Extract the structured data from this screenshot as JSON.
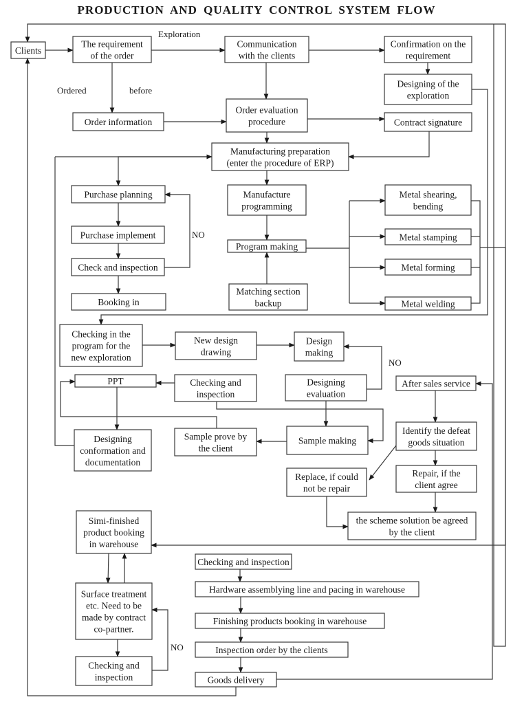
{
  "title": "PRODUCTION AND QUALITY CONTROL SYSTEM FLOW",
  "colors": {
    "line": "#3a3a3a",
    "text": "#1a1a1a",
    "background": "#ffffff"
  },
  "nodes": [
    {
      "id": "clients",
      "lines": [
        "Clients"
      ]
    },
    {
      "id": "requirement-of-order",
      "lines": [
        "The requirement",
        "of the order"
      ]
    },
    {
      "id": "communication-with-clients",
      "lines": [
        "Communication",
        "with the clients"
      ]
    },
    {
      "id": "confirmation-on-requirement",
      "lines": [
        "Confirmation on the",
        "requirement"
      ]
    },
    {
      "id": "designing-of-exploration",
      "lines": [
        "Designing of the",
        "exploration"
      ]
    },
    {
      "id": "order-information",
      "lines": [
        "Order information"
      ]
    },
    {
      "id": "order-evaluation-procedure",
      "lines": [
        "Order evaluation",
        "procedure"
      ]
    },
    {
      "id": "contract-signature",
      "lines": [
        "Contract signature"
      ]
    },
    {
      "id": "manufacturing-preparation",
      "lines": [
        "Manufacturing preparation",
        "(enter the procedure of ERP)"
      ]
    },
    {
      "id": "purchase-planning",
      "lines": [
        "Purchase planning"
      ]
    },
    {
      "id": "purchase-implement",
      "lines": [
        "Purchase implement"
      ]
    },
    {
      "id": "check-and-inspection-purchase",
      "lines": [
        "Check and inspection"
      ]
    },
    {
      "id": "booking-in",
      "lines": [
        "Booking in"
      ]
    },
    {
      "id": "manufacture-programming",
      "lines": [
        "Manufacture",
        "programming"
      ]
    },
    {
      "id": "program-making",
      "lines": [
        "Program making"
      ]
    },
    {
      "id": "matching-section-backup",
      "lines": [
        "Matching section",
        "backup"
      ]
    },
    {
      "id": "metal-shearing-bending",
      "lines": [
        "Metal shearing,",
        "bending"
      ]
    },
    {
      "id": "metal-stamping",
      "lines": [
        "Metal stamping"
      ]
    },
    {
      "id": "metal-forming",
      "lines": [
        "Metal forming"
      ]
    },
    {
      "id": "metal-welding",
      "lines": [
        "Metal welding"
      ]
    },
    {
      "id": "checking-program-new-exploration",
      "lines": [
        "Checking in the",
        "program for the",
        "new exploration"
      ]
    },
    {
      "id": "new-design-drawing",
      "lines": [
        "New design",
        "drawing"
      ]
    },
    {
      "id": "design-making",
      "lines": [
        "Design",
        "making"
      ]
    },
    {
      "id": "ppt",
      "lines": [
        "PPT"
      ]
    },
    {
      "id": "checking-and-inspection-design",
      "lines": [
        "Checking and",
        "inspection"
      ]
    },
    {
      "id": "designing-evaluation",
      "lines": [
        "Designing",
        "evaluation"
      ]
    },
    {
      "id": "after-sales-service",
      "lines": [
        "After sales service"
      ]
    },
    {
      "id": "designing-conformation-documentation",
      "lines": [
        "Designing",
        "conformation and",
        "documentation"
      ]
    },
    {
      "id": "sample-prove-by-client",
      "lines": [
        "Sample prove by",
        "the client"
      ]
    },
    {
      "id": "sample-making",
      "lines": [
        "Sample making"
      ]
    },
    {
      "id": "identify-defeat-goods",
      "lines": [
        "Identify the defeat",
        "goods situation"
      ]
    },
    {
      "id": "replace-if-not-repair",
      "lines": [
        "Replace, if could",
        "not be repair"
      ]
    },
    {
      "id": "repair-if-client-agree",
      "lines": [
        "Repair,  if the",
        "client agree"
      ]
    },
    {
      "id": "scheme-solution-agreed",
      "lines": [
        "the scheme solution be agreed",
        "by the client"
      ]
    },
    {
      "id": "semi-finished-booking",
      "lines": [
        "Simi-finished",
        "product booking",
        "in warehouse"
      ]
    },
    {
      "id": "checking-and-inspection-assembly",
      "lines": [
        "Checking and inspection"
      ]
    },
    {
      "id": "hardware-assembly-line",
      "lines": [
        "Hardware assemblying line and pacing in warehouse"
      ]
    },
    {
      "id": "surface-treatment",
      "lines": [
        "Surface treatment",
        "etc. Need to be",
        "made by contract",
        "co-partner."
      ]
    },
    {
      "id": "finishing-products-booking",
      "lines": [
        "Finishing products booking in warehouse"
      ]
    },
    {
      "id": "inspection-order-by-clients",
      "lines": [
        "Inspection order by the clients"
      ]
    },
    {
      "id": "checking-and-inspection-surface",
      "lines": [
        "Checking and",
        "inspection"
      ]
    },
    {
      "id": "goods-delivery",
      "lines": [
        "Goods delivery"
      ]
    }
  ],
  "labels": [
    {
      "id": "exploration",
      "text": "Exploration"
    },
    {
      "id": "ordered",
      "text": "Ordered"
    },
    {
      "id": "before",
      "text": "before"
    },
    {
      "id": "no-purchase",
      "text": "NO"
    },
    {
      "id": "no-design",
      "text": "NO"
    },
    {
      "id": "no-surface",
      "text": "NO"
    }
  ]
}
